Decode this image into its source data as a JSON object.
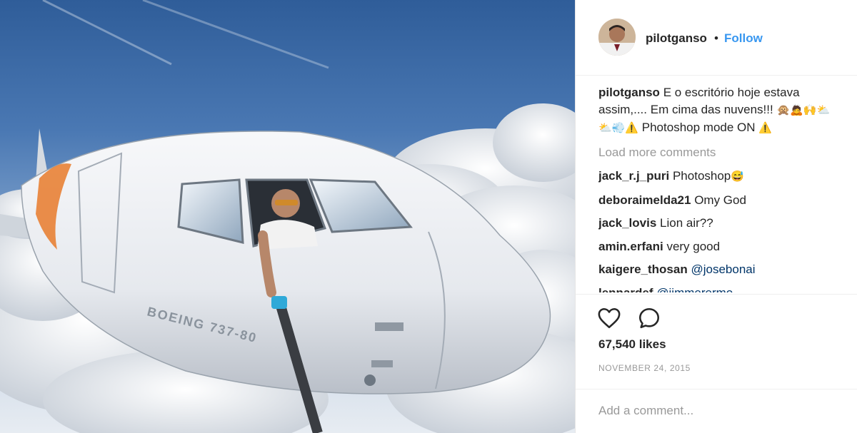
{
  "post": {
    "username": "pilotganso",
    "separator": "•",
    "follow_label": "Follow",
    "caption": {
      "username": "pilotganso",
      "text_part1": "E o escritório hoje estava assim,.... Em cima das nuvens!!!",
      "emojis1": "🙊🙇🙌⛅",
      "emojis2": "⛅💨⚠️",
      "text_part2": "Photoshop mode ON",
      "emoji_end": "⚠️"
    },
    "load_more_label": "Load more comments",
    "comments": [
      {
        "username": "jack_r.j_puri",
        "text": "Photoshop",
        "emoji": "😅"
      },
      {
        "username": "deboraimelda21",
        "text": "Omy God"
      },
      {
        "username": "jack_lovis",
        "text": "Lion air??"
      },
      {
        "username": "amin.erfani",
        "text": "very good"
      },
      {
        "username": "kaigere_thosan",
        "mention": "@josebonai"
      },
      {
        "username": "lennardef",
        "mention": "@jimmerermo"
      }
    ],
    "likes": "67,540 likes",
    "date": "NOVEMBER 24, 2015",
    "add_comment_placeholder": "Add a comment...",
    "icons": {
      "like": "heart-icon",
      "comment": "comment-bubble-icon"
    },
    "aircraft_text": "BOEING 737-80"
  },
  "colors": {
    "link": "#3897f0",
    "text": "#262626",
    "muted": "#999999",
    "mention": "#003569"
  }
}
